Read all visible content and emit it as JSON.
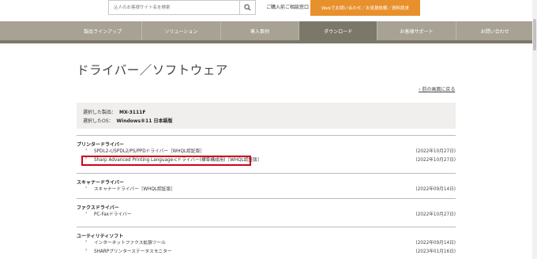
{
  "header": {
    "search_placeholder": "込人のお客様サイト名を検索",
    "purchase_link": "ご購入前ご相談窓口",
    "cta_label": "Webでお問い合わせ／お見積依頼／資料請求"
  },
  "nav": {
    "items": [
      {
        "label": "製品ラインアップ",
        "active": false
      },
      {
        "label": "ソリューション",
        "active": false
      },
      {
        "label": "導入事例",
        "active": false
      },
      {
        "label": "ダウンロード",
        "active": true
      },
      {
        "label": "お客様サポート",
        "active": false
      },
      {
        "label": "お問い合わせ",
        "active": false
      }
    ]
  },
  "page": {
    "title": "ドライバー／ソフトウェア",
    "back_link": "前の画面に戻る"
  },
  "selected": {
    "product_label": "選択した製品：",
    "product_value": "MX-3111F",
    "os_label": "選択したOS：",
    "os_value": "Windows®11 日本語版"
  },
  "sections": [
    {
      "title": "プリンタードライバー",
      "items": [
        {
          "label": "SPDL2-c/SPDL2/PS/PPDドライバー［WHQL認証版］",
          "date": "(2022年10月27日)"
        },
        {
          "label": "Sharp Advanced Printing Language-cドライバー(標準構成用)［WHQL認証版］",
          "date": "(2022年10月27日)"
        }
      ]
    },
    {
      "title": "スキャナードライバー",
      "items": [
        {
          "label": "スキャナードライバー［WHQL認証版］",
          "date": "(2022年09月14日)"
        }
      ]
    },
    {
      "title": "ファクスドライバー",
      "items": [
        {
          "label": "PC-Faxドライバー",
          "date": "(2022年10月27日)"
        }
      ]
    },
    {
      "title": "ユーティリティソフト",
      "items": [
        {
          "label": "インターネットファクス拡張ツール",
          "date": "(2022年09月14日)"
        },
        {
          "label": "SHARPプリンターステータスモニター",
          "date": "(2023年01月16日)"
        }
      ]
    }
  ],
  "colors": {
    "nav_bg": "#a7a293",
    "nav_active": "#7c7869",
    "cta": "#e8902c",
    "highlight": "#d0021b"
  }
}
